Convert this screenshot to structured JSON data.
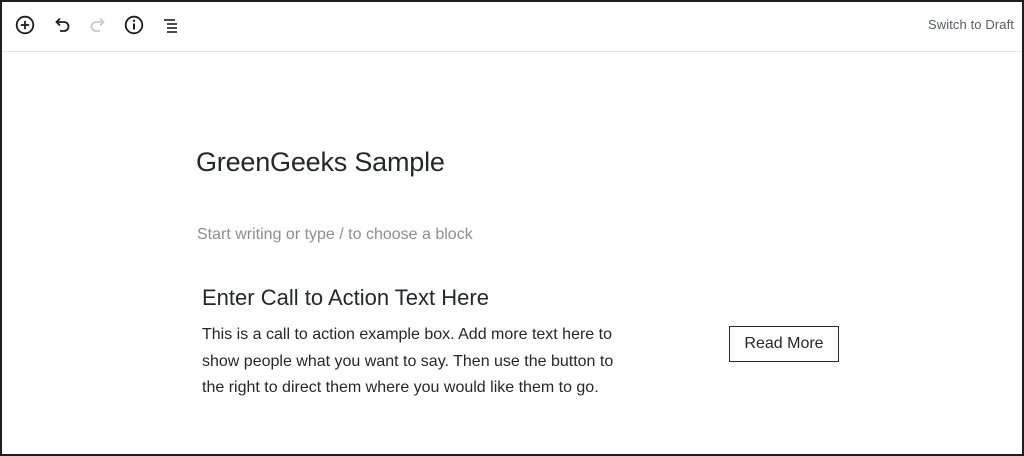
{
  "toolbar": {
    "switch_to_draft_label": "Switch to Draft"
  },
  "icons": {
    "add_block": "plus-circle-icon",
    "undo": "undo-icon",
    "redo": "redo-icon",
    "info": "info-icon",
    "outline": "block-navigation-icon"
  },
  "post": {
    "title": "GreenGeeks Sample",
    "placeholder": "Start writing or type / to choose a block"
  },
  "cta": {
    "heading": "Enter Call to Action Text Here",
    "lines": [
      "This is a call to action example box. Add more text here to",
      "show people what you want to say. Then use the button to",
      "the right to direct them where you would like them to go."
    ],
    "button_label": "Read More"
  },
  "colors": {
    "text": "#23282d",
    "placeholder": "#8a8f94",
    "toolbar_text": "#555d66",
    "redo_disabled": "#c8ccd0"
  }
}
